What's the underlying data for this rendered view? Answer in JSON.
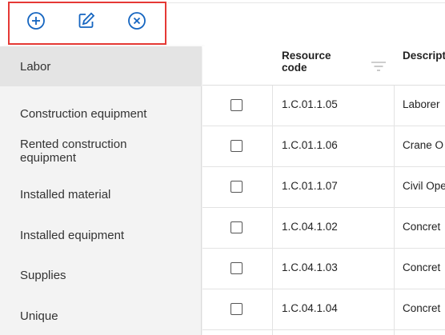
{
  "toolbar": {
    "add_icon": "plus-circle-icon",
    "edit_icon": "edit-icon",
    "delete_icon": "x-circle-icon",
    "highlight_color": "#e53935",
    "icon_color": "#1565c0"
  },
  "sidebar": {
    "items": [
      {
        "label": "Labor"
      },
      {
        "label": "Construction equipment"
      },
      {
        "label": "Rented construction equipment"
      },
      {
        "label": "Installed material"
      },
      {
        "label": "Installed equipment"
      },
      {
        "label": "Supplies"
      },
      {
        "label": "Unique"
      }
    ],
    "active_index": 0
  },
  "table": {
    "columns": [
      {
        "label": "Resource code"
      },
      {
        "label": "Descript"
      }
    ],
    "rows": [
      {
        "code": "1.C.01.1.05",
        "description": "Laborer"
      },
      {
        "code": "1.C.01.1.06",
        "description": "Crane O"
      },
      {
        "code": "1.C.01.1.07",
        "description": "Civil Ope"
      },
      {
        "code": "1.C.04.1.02",
        "description": "Concret"
      },
      {
        "code": "1.C.04.1.03",
        "description": "Concret"
      },
      {
        "code": "1.C.04.1.04",
        "description": "Concret"
      }
    ]
  }
}
